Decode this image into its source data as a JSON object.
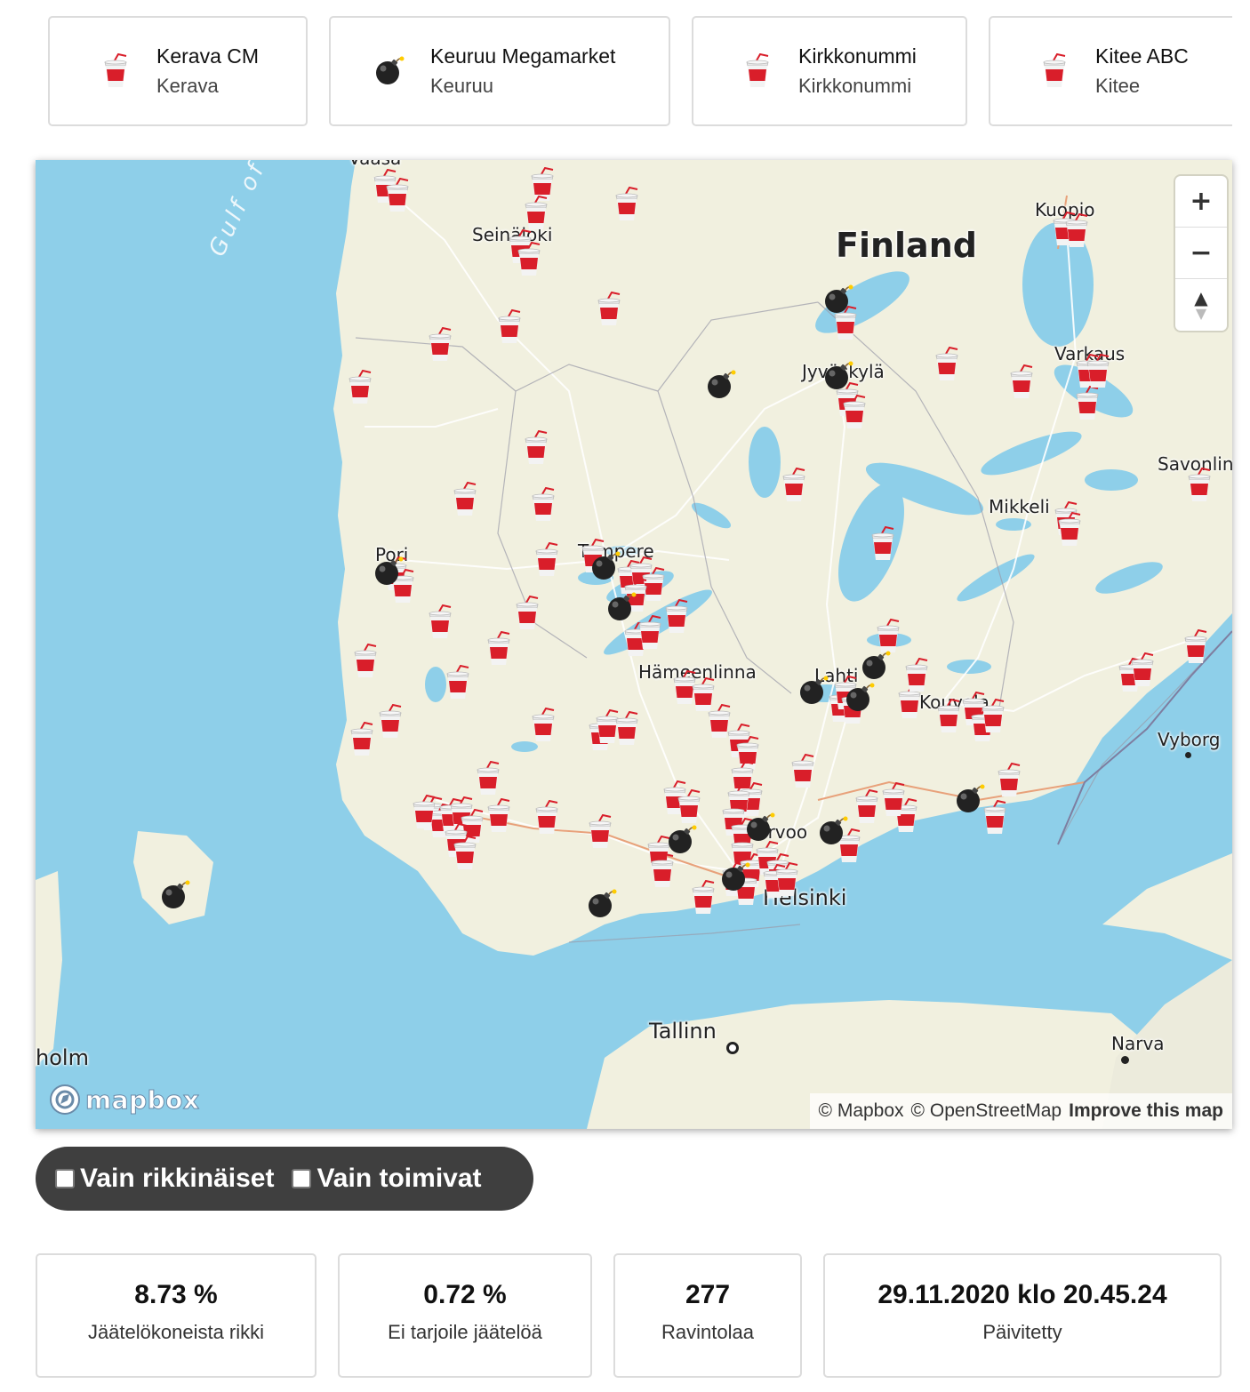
{
  "restaurants": [
    {
      "name": "Kerava CM",
      "city": "Kerava",
      "icon": "drink-cup-icon"
    },
    {
      "name": "Keuruu Megamarket",
      "city": "Keuruu",
      "icon": "bomb-icon"
    },
    {
      "name": "Kirkkonummi",
      "city": "Kirkkonummi",
      "icon": "drink-cup-icon"
    },
    {
      "name": "Kitee ABC",
      "city": "Kitee",
      "icon": "drink-cup-icon"
    }
  ],
  "map": {
    "labels": {
      "finland": "Finland",
      "gulf": "Gulf of",
      "vaasa": "Vaasa",
      "seinajoki": "Seinäjoki",
      "kuopio": "Kuopio",
      "jyvaskyla": "Jyväskylä",
      "varkaus": "Varkaus",
      "savonlinna": "Savonlin",
      "mikkeli": "Mikkeli",
      "pori": "Pori",
      "tampere": "Tampere",
      "hameenlinna": "Hämeenlinna",
      "lahti": "Lahti",
      "kouvola": "Kouvola",
      "vyborg": "Vyborg",
      "porvoo": "Porvoo",
      "helsinki": "Helsinki",
      "tallinn": "Tallinn",
      "narva": "Narva",
      "stockholm": "holm"
    },
    "zoom_in": "+",
    "zoom_out": "−",
    "compass": "▲",
    "attribution": {
      "mapbox": "© Mapbox",
      "osm": "© OpenStreetMap",
      "improve": "Improve this map"
    },
    "logo": "mapbox"
  },
  "filters": {
    "only_broken": "Vain rikkinäiset",
    "only_working": "Vain toimivat"
  },
  "stats": [
    {
      "value": "8.73 %",
      "label": "Jäätelökoneista rikki"
    },
    {
      "value": "0.72 %",
      "label": "Ei tarjoile jäätelöä"
    },
    {
      "value": "277",
      "label": "Ravintolaa"
    },
    {
      "value": "29.11.2020 klo 20.45.24",
      "label": "Päivitetty"
    }
  ]
}
